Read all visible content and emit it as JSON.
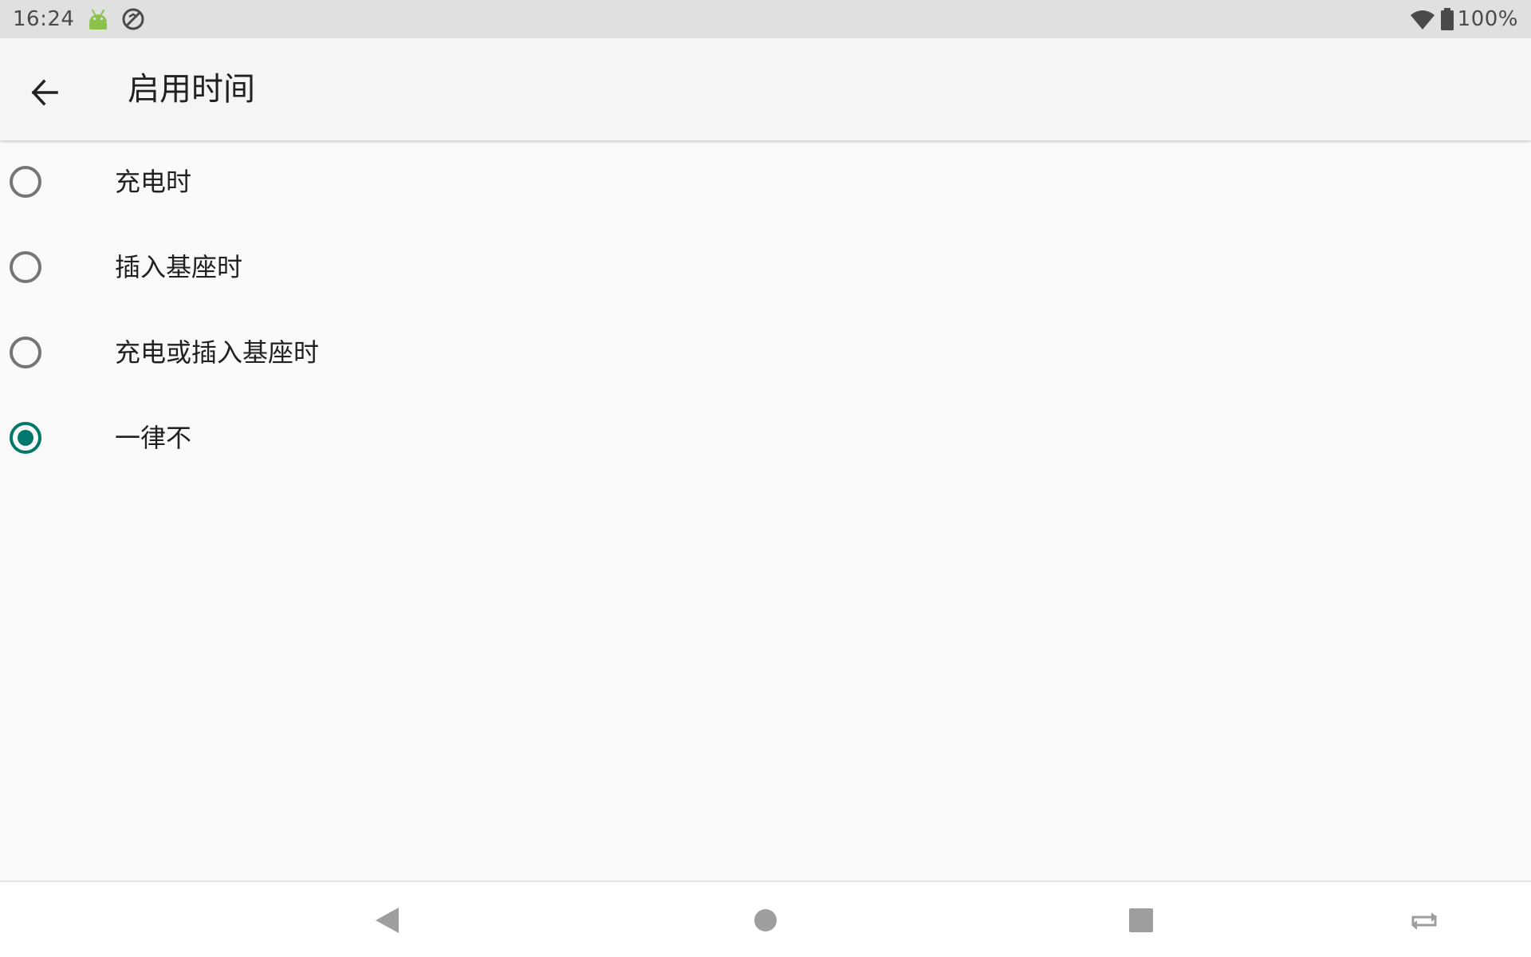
{
  "status_bar": {
    "time": "16:24",
    "left_icons": [
      "android-icon",
      "sync-disabled-icon"
    ],
    "right_icons": [
      "wifi-icon",
      "battery-icon"
    ],
    "battery_text": "100%"
  },
  "app_bar": {
    "back_icon": "arrow-back-icon",
    "title": "启用时间"
  },
  "options": [
    {
      "label": "充电时",
      "selected": false
    },
    {
      "label": "插入基座时",
      "selected": false
    },
    {
      "label": "充电或插入基座时",
      "selected": false
    },
    {
      "label": "一律不",
      "selected": true
    }
  ],
  "nav_bar": {
    "buttons": [
      "nav-back-icon",
      "nav-home-icon",
      "nav-recents-icon",
      "rotate-icon"
    ]
  },
  "colors": {
    "accent": "#00796b",
    "status_bar_bg": "#e0e0e0",
    "app_bar_bg": "#f5f5f5",
    "page_bg": "#fafafa",
    "android_green": "#8bc34a"
  }
}
